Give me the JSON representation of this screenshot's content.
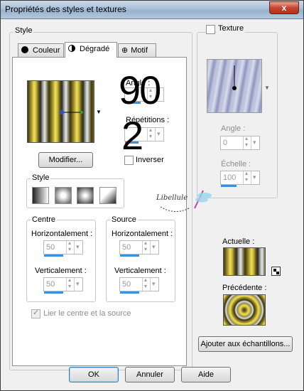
{
  "window": {
    "title": "Propriétés des styles et textures",
    "close_glyph": "x"
  },
  "style_group": {
    "label": "Style"
  },
  "tabs": [
    {
      "label": "Couleur",
      "icon": "filled-circle-icon"
    },
    {
      "label": "Dégradé",
      "icon": "half-circle-icon"
    },
    {
      "label": "Motif",
      "icon": "pattern-globe-icon"
    }
  ],
  "gradient": {
    "angle_label": "Angle :",
    "angle_value": "90",
    "repetitions_label": "Répétitions :",
    "repetitions_value": "2",
    "invert_label": "Inverser",
    "modify_button": "Modifier...",
    "style_label": "Style"
  },
  "centre": {
    "label": "Centre",
    "horiz_label": "Horizontalement :",
    "horiz_value": "50",
    "vert_label": "Verticalement :",
    "vert_value": "50"
  },
  "source": {
    "label": "Source",
    "horiz_label": "Horizontalement :",
    "horiz_value": "50",
    "vert_label": "Verticalement :",
    "vert_value": "50"
  },
  "link_label": "Lier le centre et la source",
  "watermark": "Libellule",
  "texture": {
    "label": "Texture",
    "angle_label": "Angle :",
    "angle_value": "0",
    "scale_label": "Échelle :",
    "scale_value": "100"
  },
  "current_label": "Actuelle :",
  "previous_label": "Précédente :",
  "add_button": "Ajouter aux échantillons...",
  "buttons": {
    "ok": "OK",
    "cancel": "Annuler",
    "help": "Aide"
  },
  "colors": {
    "accent": "#3f8fe0",
    "gold": "#c8b53a",
    "close": "#c7432f"
  }
}
